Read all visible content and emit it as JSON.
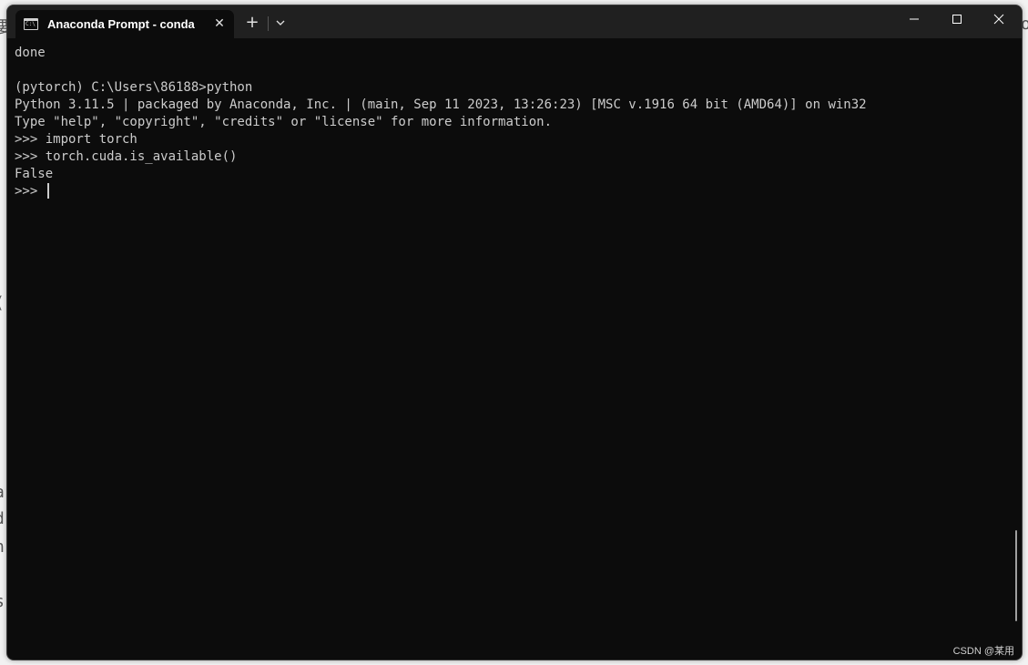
{
  "background_fragments": [
    {
      "id": "frag-1",
      "text": "要"
    },
    {
      "id": "frag-2",
      "text": "o"
    },
    {
      "id": "frag-3",
      "text": "("
    },
    {
      "id": "frag-4",
      "text": "a"
    },
    {
      "id": "frag-5",
      "text": "d"
    },
    {
      "id": "frag-6",
      "text": "n"
    },
    {
      "id": "frag-7",
      "text": "s"
    }
  ],
  "window": {
    "tab": {
      "icon": "console-icon",
      "icon_text": "C:\\",
      "title": "Anaconda Prompt - conda  in",
      "close_glyph": "✕"
    },
    "new_tab_glyph": "+",
    "dropdown_icon": "chevron-down-icon",
    "controls": {
      "minimize": "minimize-icon",
      "maximize": "maximize-icon",
      "close": "close-icon"
    }
  },
  "terminal": {
    "lines": [
      "done",
      "",
      "(pytorch) C:\\Users\\86188>python",
      "Python 3.11.5 | packaged by Anaconda, Inc. | (main, Sep 11 2023, 13:26:23) [MSC v.1916 64 bit (AMD64)] on win32",
      "Type \"help\", \"copyright\", \"credits\" or \"license\" for more information.",
      ">>> import torch",
      ">>> torch.cuda.is_available()",
      "False"
    ],
    "prompt": ">>> "
  },
  "watermark": "CSDN @某用",
  "colors": {
    "terminal_bg": "#0c0c0c",
    "titlebar_bg": "#202020",
    "terminal_fg": "#cccccc"
  }
}
